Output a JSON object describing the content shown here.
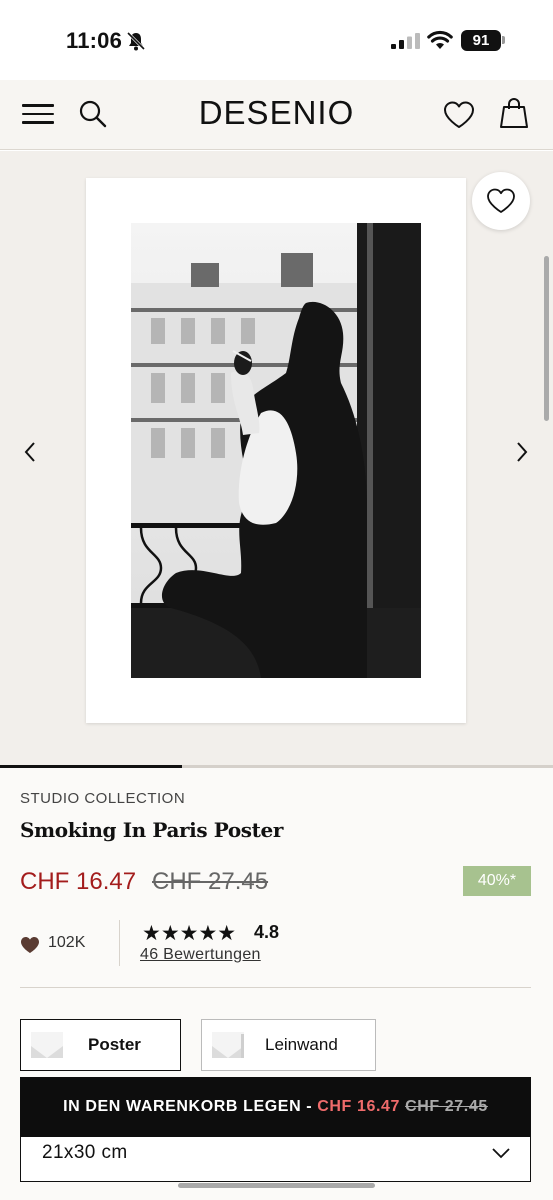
{
  "status_bar": {
    "time": "11:06",
    "battery": "91"
  },
  "header": {
    "logo": "DESENIO"
  },
  "gallery": {
    "slide_progress": 0.33
  },
  "product": {
    "collection": "STUDIO COLLECTION",
    "title": "Smoking In Paris Poster",
    "price_now": "CHF 16.47",
    "price_old": "CHF 27.45",
    "discount": "40%*",
    "likes": "102K",
    "stars": "★★★★★",
    "rating": "4.8",
    "reviews": "46 Bewertungen"
  },
  "options": {
    "poster": "Poster",
    "canvas": "Leinwand"
  },
  "cart": {
    "label": "IN DEN WARENKORB LEGEN - ",
    "price_now": "CHF 16.47",
    "price_old": "CHF 27.45"
  },
  "size": {
    "selected": "21x30 cm"
  },
  "colors": {
    "sale_red": "#a31c1c",
    "discount_green": "#a7c28f",
    "cart_bg": "#0d0d0d"
  }
}
